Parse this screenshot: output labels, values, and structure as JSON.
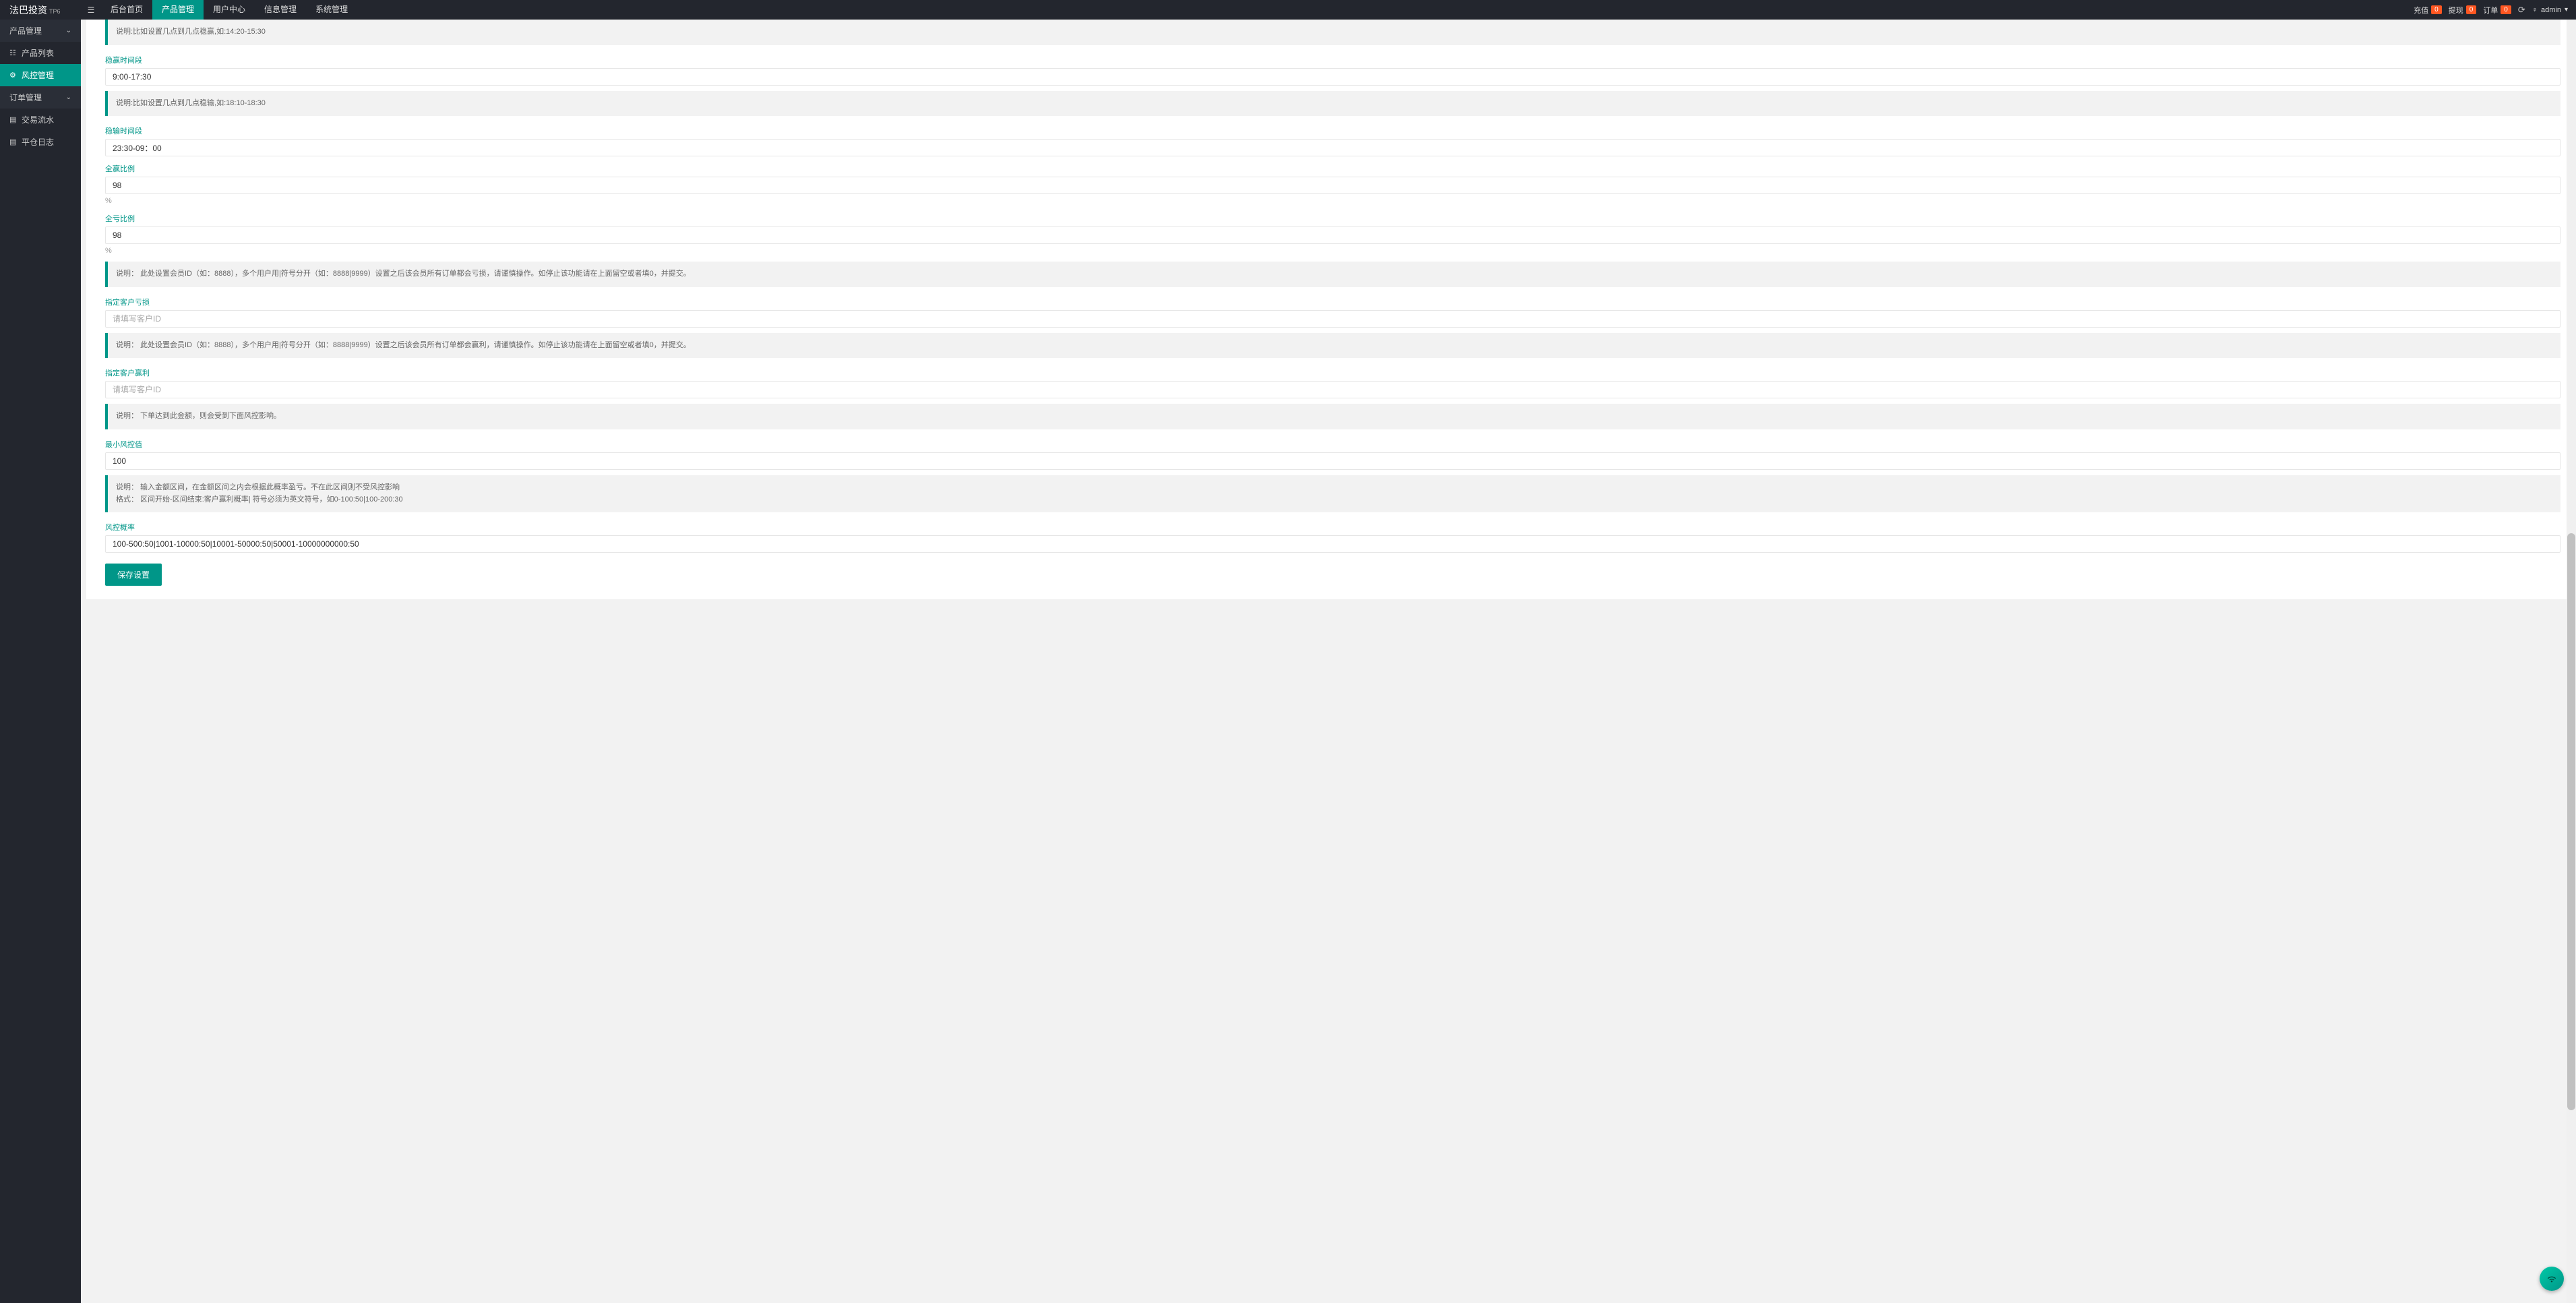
{
  "app": {
    "name": "法巴投资",
    "superscript": "TP6"
  },
  "topnav": {
    "items": [
      {
        "label": "后台首页"
      },
      {
        "label": "产品管理",
        "active": true
      },
      {
        "label": "用户中心"
      },
      {
        "label": "信息管理"
      },
      {
        "label": "系统管理"
      }
    ]
  },
  "header_right": {
    "recharge": {
      "label": "充值",
      "count": "0"
    },
    "withdraw": {
      "label": "提现",
      "count": "0"
    },
    "order": {
      "label": "订单",
      "count": "0"
    },
    "user": "admin"
  },
  "sidebar": {
    "group_product": "产品管理",
    "item_product_list": "产品列表",
    "item_risk_control": "风控管理",
    "group_order": "订单管理",
    "item_trade_flow": "交易流水",
    "item_close_log": "平仓日志"
  },
  "form": {
    "note_stable_win_example": "说明:比如设置几点到几点稳赢,如:14:20-15:30",
    "stable_win_time": {
      "label": "稳赢时间段",
      "value": "9:00-17:30"
    },
    "note_stable_lose_example": "说明:比如设置几点到几点稳输,如:18:10-18:30",
    "stable_lose_time": {
      "label": "稳输时间段",
      "value": "23:30-09：00"
    },
    "all_win_ratio": {
      "label": "全赢比例",
      "value": "98",
      "suffix": "%"
    },
    "all_lose_ratio": {
      "label": "全亏比例",
      "value": "98",
      "suffix": "%"
    },
    "note_member_lose": "说明：  此处设置会员ID（如：8888），多个用户用|符号分开（如：8888|9999）设置之后该会员所有订单都会亏损，请谨慎操作。如停止该功能请在上面留空或者填0，并提交。",
    "assign_customer_loss": {
      "label": "指定客户亏损",
      "placeholder": "请填写客户ID",
      "value": ""
    },
    "note_member_profit": "说明：  此处设置会员ID（如：8888），多个用户用|符号分开（如：8888|9999）设置之后该会员所有订单都会赢利，请谨慎操作。如停止该功能请在上面留空或者填0，并提交。",
    "assign_customer_profit": {
      "label": "指定客户赢利",
      "placeholder": "请填写客户ID",
      "value": ""
    },
    "note_min_risk": "说明：  下单达到此金额，则会受到下面风控影响。",
    "min_risk_value": {
      "label": "最小风控值",
      "value": "100"
    },
    "note_risk_prob_line1": "说明：  输入金额区间，在金额区间之内会根据此概率盈亏。不在此区间则不受风控影响",
    "note_risk_prob_line2": "格式：  区间开始-区间结束:客户赢利概率|        符号必须为英文符号，如0-100:50|100-200:30",
    "risk_prob": {
      "label": "风控概率",
      "value": "100-500:50|1001-10000:50|10001-50000:50|50001-10000000000:50"
    },
    "submit": "保存设置"
  }
}
